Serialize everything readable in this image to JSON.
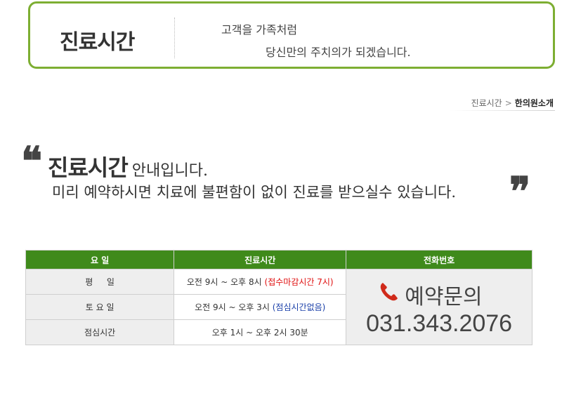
{
  "header": {
    "title": "진료시간",
    "slogan_line1": "고객을 가족처럼",
    "slogan_line2": "당신만의 주치의가 되겠습니다."
  },
  "breadcrumb": {
    "parent": "진료시간",
    "separator": ">",
    "current": "한의원소개"
  },
  "intro": {
    "open_quote": "❝",
    "close_quote": "❞",
    "headline": "진료시간",
    "headline_suffix": "안내입니다.",
    "subline": "미리 예약하시면 치료에 불편함이 없이 진료를 받으실수 있습니다."
  },
  "table": {
    "headers": [
      "요 일",
      "진료시간",
      "전화번호"
    ],
    "rows": [
      {
        "day": "평 　 일",
        "time": "오전 9시 ~ 오후 8시",
        "note": "(접수마감시간 7시)"
      },
      {
        "day": "토 요 일",
        "time": "오전 9시 ~ 오후 3시",
        "note": "(점심시간없음)"
      },
      {
        "day": "점심시간",
        "time": "오후 1시 ~ 오후 2시 30분",
        "note": ""
      }
    ],
    "contact": {
      "label": "예약문의",
      "phone": "031.343.2076",
      "icon": "phone-icon"
    }
  },
  "colors": {
    "header_border": "#7dae32",
    "table_header": "#3f8a1b",
    "note_red": "#e01010",
    "note_blue": "#1a3fa8"
  }
}
